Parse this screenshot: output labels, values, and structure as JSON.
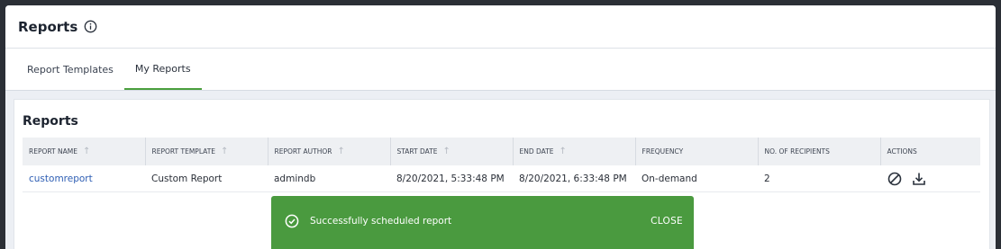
{
  "header": {
    "title": "Reports",
    "info_icon": "info-icon"
  },
  "tabs": [
    {
      "label": "Report Templates",
      "active": false
    },
    {
      "label": "My Reports",
      "active": true
    }
  ],
  "panel": {
    "title": "Reports",
    "columns": [
      "REPORT NAME",
      "REPORT TEMPLATE",
      "REPORT AUTHOR",
      "START DATE",
      "END DATE",
      "FREQUENCY",
      "NO. OF RECIPIENTS",
      "ACTIONS"
    ],
    "rows": [
      {
        "name": "customreport",
        "template": "Custom Report",
        "author": "admindb",
        "start": "8/20/2021, 5:33:48 PM",
        "end": "8/20/2021, 6:33:48 PM",
        "frequency": "On-demand",
        "recipients": "2",
        "actions": [
          "cancel-icon",
          "download-icon"
        ]
      }
    ]
  },
  "toast": {
    "message": "Successfully scheduled report",
    "close_label": "CLOSE",
    "icon": "check-circle-icon",
    "color": "#4a9a3f"
  },
  "colors": {
    "accent": "#4a9f3d",
    "link": "#2f5fb4"
  }
}
